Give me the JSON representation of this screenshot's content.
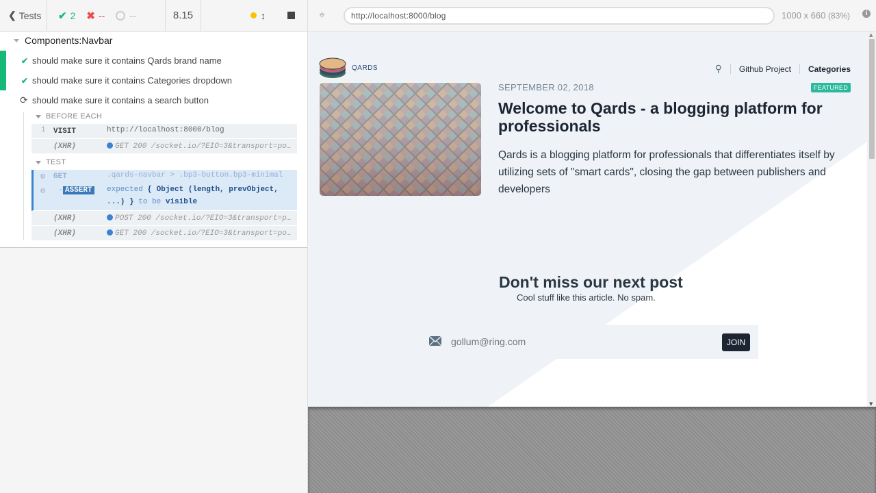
{
  "reporter": {
    "header": {
      "tests_label": "Tests",
      "passed": "2",
      "failed": "--",
      "pending": "--",
      "duration": "8.15"
    },
    "suite": {
      "title": "Components:Navbar",
      "tests": [
        {
          "label": "should make sure it contains Qards brand name",
          "state": "passed"
        },
        {
          "label": "should make sure it contains Categories dropdown",
          "state": "passed"
        },
        {
          "label": "should make sure it contains a search button",
          "state": "running"
        }
      ],
      "before_each_label": "BEFORE EACH",
      "test_label": "TEST",
      "before_each_cmds": [
        {
          "num": "1",
          "name": "VISIT",
          "msg": "http://localhost:8000/blog"
        },
        {
          "num": "",
          "name": "(XHR)",
          "msg": "GET 200 /socket.io/?EIO=3&transport=polling"
        }
      ],
      "test_cmds": {
        "get": {
          "name": "GET",
          "msg": ".qards-navbar > .bp3-button.bp3-minimal"
        },
        "assert": {
          "dash": "-",
          "badge": "ASSERT",
          "expected": "expected",
          "object": "{ Object (length, prevObject,",
          "object2": "...) }",
          "to_be": "to be",
          "visible": "visible"
        },
        "xhr": [
          {
            "name": "(XHR)",
            "msg": "POST 200 /socket.io/?EIO=3&transport=polling"
          },
          {
            "name": "(XHR)",
            "msg": "GET 200 /socket.io/?EIO=3&transport=polling"
          }
        ]
      }
    }
  },
  "aut": {
    "url": "http://localhost:8000/blog",
    "viewport": "1000 x 660",
    "scale": "(83%)",
    "site": {
      "brand": "QARDS",
      "nav": [
        "Github Project",
        "Categories"
      ],
      "post": {
        "date": "SEPTEMBER 02, 2018",
        "badge": "FEATURED",
        "title": "Welcome to Qards - a blogging platform for professionals",
        "excerpt": "Qards is a blogging platform for professionals that differentiates itself by utilizing sets of \"smart cards\", closing the gap between publishers and developers"
      },
      "newsletter": {
        "title": "Don't miss our next post",
        "subtitle": "Cool stuff like this article. No spam.",
        "placeholder": "gollum@ring.com",
        "button": "JOIN"
      }
    }
  },
  "colors": {
    "pass": "#17b978",
    "fail": "#e94f4f",
    "accent": "#3b82d0",
    "featured": "#2bb99b",
    "site_dark": "#1c2633"
  },
  "icons": [
    "chevron-left-icon",
    "check-icon",
    "x-icon",
    "pending-ring-icon",
    "status-dot-icon",
    "scroll-toggle-icon",
    "stop-icon",
    "selector-playground-icon",
    "info-icon",
    "search-icon",
    "mail-icon",
    "refresh-spinner-icon",
    "qards-logo-icon"
  ]
}
